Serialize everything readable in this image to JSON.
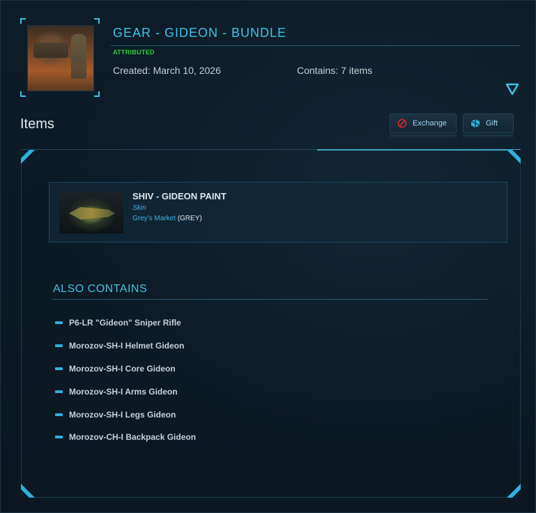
{
  "header": {
    "title": "GEAR - GIDEON - BUNDLE",
    "status": "ATTRIBUTED",
    "created": "Created: March 10, 2026",
    "contains": "Contains: 7 items"
  },
  "items_section": {
    "title": "Items",
    "exchange_label": "Exchange",
    "gift_label": "Gift"
  },
  "featured_item": {
    "name": "SHIV - GIDEON PAINT",
    "type": "Skin",
    "manufacturer": "Grey's Market",
    "grade": "(GREY)"
  },
  "also_contains": {
    "title": "ALSO CONTAINS",
    "items": [
      "P6-LR \"Gideon\" Sniper Rifle",
      "Morozov-SH-I Helmet Gideon",
      "Morozov-SH-I Core Gideon",
      "Morozov-SH-I Arms Gideon",
      "Morozov-SH-I Legs Gideon",
      "Morozov-CH-I Backpack Gideon"
    ]
  },
  "colors": {
    "accent": "#3fc3e8",
    "status_green": "#31d13a",
    "background": "#0b1a26"
  },
  "icons": {
    "expand": "triangle-down-icon",
    "exchange": "exchange-icon",
    "gift": "gift-icon"
  }
}
